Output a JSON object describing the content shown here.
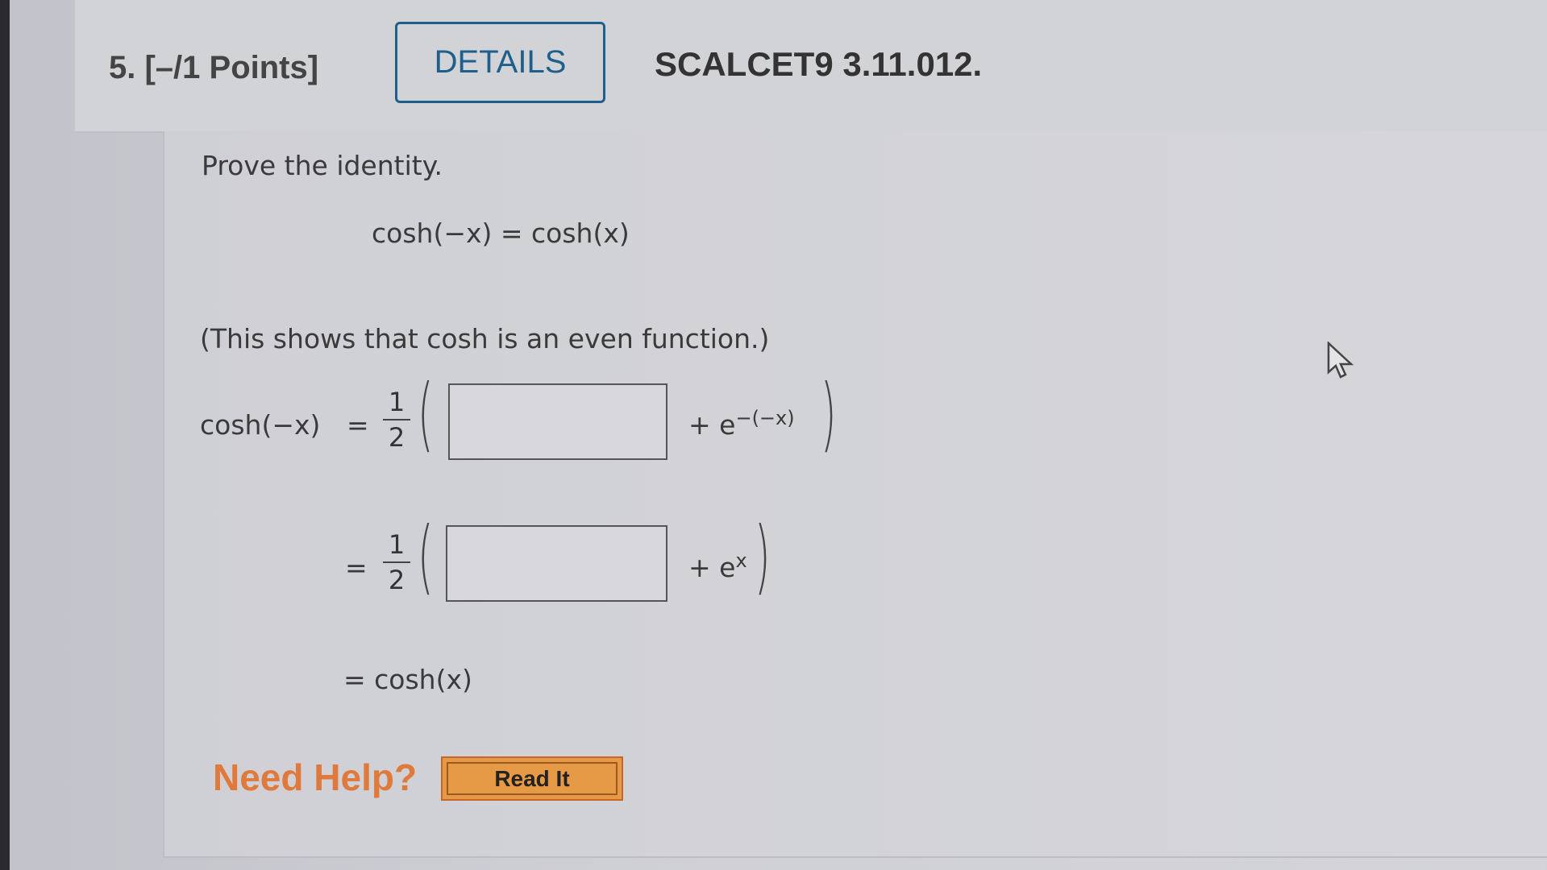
{
  "question": {
    "number_points": "5. [–/1 Points]",
    "details_label": "DETAILS",
    "code": "SCALCET9 3.11.012."
  },
  "body": {
    "prompt": "Prove the identity.",
    "identity": "cosh(−x) = cosh(x)",
    "note": "(This shows that cosh is an even function.)",
    "row1": {
      "lhs": "cosh(−x)",
      "eq": "=",
      "num": "1",
      "den": "2",
      "input_value": "",
      "plus": "+ e",
      "exp": "−(−x)"
    },
    "row2": {
      "eq": "=",
      "num": "1",
      "den": "2",
      "input_value": "",
      "plus": "+ e",
      "exp": "x"
    },
    "row3": {
      "text": "= cosh(x)"
    }
  },
  "help": {
    "label": "Need Help?",
    "read_it": "Read It"
  },
  "colors": {
    "details_border": "#1f5f8b",
    "need_help": "#e07a3c",
    "read_it_bg": "#e79a45"
  }
}
